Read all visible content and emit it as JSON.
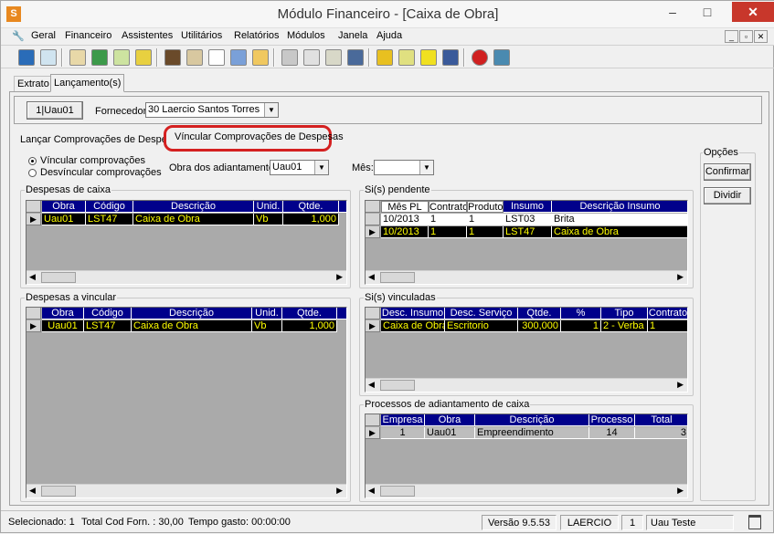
{
  "window": {
    "title": "Módulo Financeiro - [Caixa de Obra]",
    "app_icon": "S"
  },
  "menu": [
    "Geral",
    "Financeiro",
    "Assistentes",
    "Utilitários",
    "Relatórios",
    "Módulos",
    "Janela",
    "Ajuda"
  ],
  "toolbar_icons": [
    "network-icon",
    "chart-icon",
    "home-icon",
    "spreadsheet-icon",
    "edit-icon",
    "list-icon",
    "books-icon",
    "earth-icon",
    "calendar-icon",
    "tools-icon",
    "form-icon",
    "print-icon",
    "copy-icon",
    "paste-icon",
    "calculator-icon",
    "lock-icon",
    "filter-icon",
    "lightning-icon",
    "grid-icon",
    "help-icon",
    "exit-icon"
  ],
  "tabs": {
    "extrato": "Extrato",
    "lancamentos": "Lançamento(s)"
  },
  "header": {
    "code_button": "1|Uau01",
    "fornecedor_label": "Fornecedor:",
    "fornecedor_value": "30  Laercio Santos Torres"
  },
  "subtabs": {
    "lancar": "Lançar Comprovações de Despesas",
    "vincular": "Víncular Comprovações de Despesas"
  },
  "highlight_color": "#d42020",
  "options": {
    "vincular": "Víncular comprovações",
    "desvincular": "Desvíncular comprovações",
    "obra_label": "Obra dos adiantamentos:",
    "obra_value": "Uau01",
    "mes_label": "Mês:",
    "mes_value": ""
  },
  "opcoes": {
    "title": "Opções",
    "confirmar": "Confirmar",
    "dividir": "Dividir"
  },
  "despesas_caixa": {
    "title": "Despesas de caixa",
    "headers": [
      "Obra",
      "Código",
      "Descrição",
      "Unid.",
      "Qtde."
    ],
    "rows": [
      [
        "Uau01",
        "LST47",
        "Caixa de Obra",
        "Vb",
        "1,000"
      ]
    ]
  },
  "despesas_vincular": {
    "title": "Despesas a vincular",
    "headers": [
      "Obra",
      "Código",
      "Descrição",
      "Unid.",
      "Qtde."
    ],
    "rows": [
      [
        "Uau01",
        "LST47",
        "Caixa de Obra",
        "Vb",
        "1,000"
      ]
    ]
  },
  "si_pendente": {
    "title": "Si(s) pendente",
    "headers": [
      "Mês PL",
      "Contrato",
      "Produto",
      "Insumo",
      "Descrição Insumo"
    ],
    "rows": [
      [
        "10/2013",
        "1",
        "1",
        "LST03",
        "Brita"
      ],
      [
        "10/2013",
        "1",
        "1",
        "LST47",
        "Caixa de Obra"
      ]
    ]
  },
  "si_vinculadas": {
    "title": "Si(s) vinculadas",
    "headers": [
      "Desc. Insumo",
      "Desc. Serviço",
      "Qtde.",
      "%",
      "Tipo",
      "Contrato"
    ],
    "rows": [
      [
        "Caixa de Obra",
        "Escritorio",
        "300,000",
        "1",
        "2 - Verba",
        "1"
      ]
    ]
  },
  "processos": {
    "title": "Processos de adiantamento de caixa",
    "headers": [
      "Empresa",
      "Obra",
      "Descrição",
      "Processo",
      "Total"
    ],
    "rows": [
      [
        "1",
        "Uau01",
        "Empreendimento",
        "14",
        "3"
      ]
    ]
  },
  "status": {
    "selecionado": "Selecionado: 1",
    "total": "Total Cod Forn. : 30,00",
    "tempo": "Tempo gasto: 00:00:00",
    "versao": "Versão 9.5.53",
    "user": "LAERCIO",
    "num": "1",
    "company": "Uau Teste"
  }
}
